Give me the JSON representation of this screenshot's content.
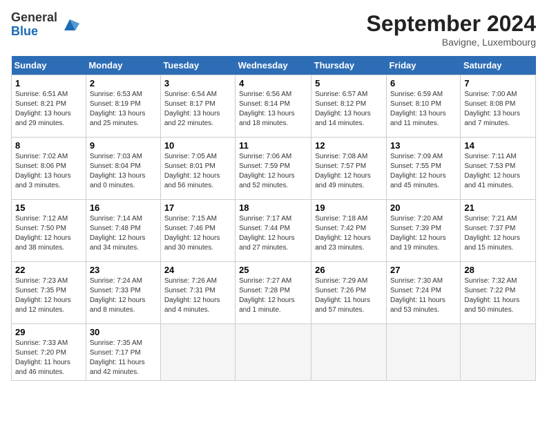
{
  "header": {
    "logo_general": "General",
    "logo_blue": "Blue",
    "month_title": "September 2024",
    "location": "Bavigne, Luxembourg"
  },
  "weekdays": [
    "Sunday",
    "Monday",
    "Tuesday",
    "Wednesday",
    "Thursday",
    "Friday",
    "Saturday"
  ],
  "weeks": [
    [
      {
        "day": "1",
        "info": "Sunrise: 6:51 AM\nSunset: 8:21 PM\nDaylight: 13 hours\nand 29 minutes."
      },
      {
        "day": "2",
        "info": "Sunrise: 6:53 AM\nSunset: 8:19 PM\nDaylight: 13 hours\nand 25 minutes."
      },
      {
        "day": "3",
        "info": "Sunrise: 6:54 AM\nSunset: 8:17 PM\nDaylight: 13 hours\nand 22 minutes."
      },
      {
        "day": "4",
        "info": "Sunrise: 6:56 AM\nSunset: 8:14 PM\nDaylight: 13 hours\nand 18 minutes."
      },
      {
        "day": "5",
        "info": "Sunrise: 6:57 AM\nSunset: 8:12 PM\nDaylight: 13 hours\nand 14 minutes."
      },
      {
        "day": "6",
        "info": "Sunrise: 6:59 AM\nSunset: 8:10 PM\nDaylight: 13 hours\nand 11 minutes."
      },
      {
        "day": "7",
        "info": "Sunrise: 7:00 AM\nSunset: 8:08 PM\nDaylight: 13 hours\nand 7 minutes."
      }
    ],
    [
      {
        "day": "8",
        "info": "Sunrise: 7:02 AM\nSunset: 8:06 PM\nDaylight: 13 hours\nand 3 minutes."
      },
      {
        "day": "9",
        "info": "Sunrise: 7:03 AM\nSunset: 8:04 PM\nDaylight: 13 hours\nand 0 minutes."
      },
      {
        "day": "10",
        "info": "Sunrise: 7:05 AM\nSunset: 8:01 PM\nDaylight: 12 hours\nand 56 minutes."
      },
      {
        "day": "11",
        "info": "Sunrise: 7:06 AM\nSunset: 7:59 PM\nDaylight: 12 hours\nand 52 minutes."
      },
      {
        "day": "12",
        "info": "Sunrise: 7:08 AM\nSunset: 7:57 PM\nDaylight: 12 hours\nand 49 minutes."
      },
      {
        "day": "13",
        "info": "Sunrise: 7:09 AM\nSunset: 7:55 PM\nDaylight: 12 hours\nand 45 minutes."
      },
      {
        "day": "14",
        "info": "Sunrise: 7:11 AM\nSunset: 7:53 PM\nDaylight: 12 hours\nand 41 minutes."
      }
    ],
    [
      {
        "day": "15",
        "info": "Sunrise: 7:12 AM\nSunset: 7:50 PM\nDaylight: 12 hours\nand 38 minutes."
      },
      {
        "day": "16",
        "info": "Sunrise: 7:14 AM\nSunset: 7:48 PM\nDaylight: 12 hours\nand 34 minutes."
      },
      {
        "day": "17",
        "info": "Sunrise: 7:15 AM\nSunset: 7:46 PM\nDaylight: 12 hours\nand 30 minutes."
      },
      {
        "day": "18",
        "info": "Sunrise: 7:17 AM\nSunset: 7:44 PM\nDaylight: 12 hours\nand 27 minutes."
      },
      {
        "day": "19",
        "info": "Sunrise: 7:18 AM\nSunset: 7:42 PM\nDaylight: 12 hours\nand 23 minutes."
      },
      {
        "day": "20",
        "info": "Sunrise: 7:20 AM\nSunset: 7:39 PM\nDaylight: 12 hours\nand 19 minutes."
      },
      {
        "day": "21",
        "info": "Sunrise: 7:21 AM\nSunset: 7:37 PM\nDaylight: 12 hours\nand 15 minutes."
      }
    ],
    [
      {
        "day": "22",
        "info": "Sunrise: 7:23 AM\nSunset: 7:35 PM\nDaylight: 12 hours\nand 12 minutes."
      },
      {
        "day": "23",
        "info": "Sunrise: 7:24 AM\nSunset: 7:33 PM\nDaylight: 12 hours\nand 8 minutes."
      },
      {
        "day": "24",
        "info": "Sunrise: 7:26 AM\nSunset: 7:31 PM\nDaylight: 12 hours\nand 4 minutes."
      },
      {
        "day": "25",
        "info": "Sunrise: 7:27 AM\nSunset: 7:28 PM\nDaylight: 12 hours\nand 1 minute."
      },
      {
        "day": "26",
        "info": "Sunrise: 7:29 AM\nSunset: 7:26 PM\nDaylight: 11 hours\nand 57 minutes."
      },
      {
        "day": "27",
        "info": "Sunrise: 7:30 AM\nSunset: 7:24 PM\nDaylight: 11 hours\nand 53 minutes."
      },
      {
        "day": "28",
        "info": "Sunrise: 7:32 AM\nSunset: 7:22 PM\nDaylight: 11 hours\nand 50 minutes."
      }
    ],
    [
      {
        "day": "29",
        "info": "Sunrise: 7:33 AM\nSunset: 7:20 PM\nDaylight: 11 hours\nand 46 minutes."
      },
      {
        "day": "30",
        "info": "Sunrise: 7:35 AM\nSunset: 7:17 PM\nDaylight: 11 hours\nand 42 minutes."
      },
      {
        "day": "",
        "info": ""
      },
      {
        "day": "",
        "info": ""
      },
      {
        "day": "",
        "info": ""
      },
      {
        "day": "",
        "info": ""
      },
      {
        "day": "",
        "info": ""
      }
    ]
  ]
}
